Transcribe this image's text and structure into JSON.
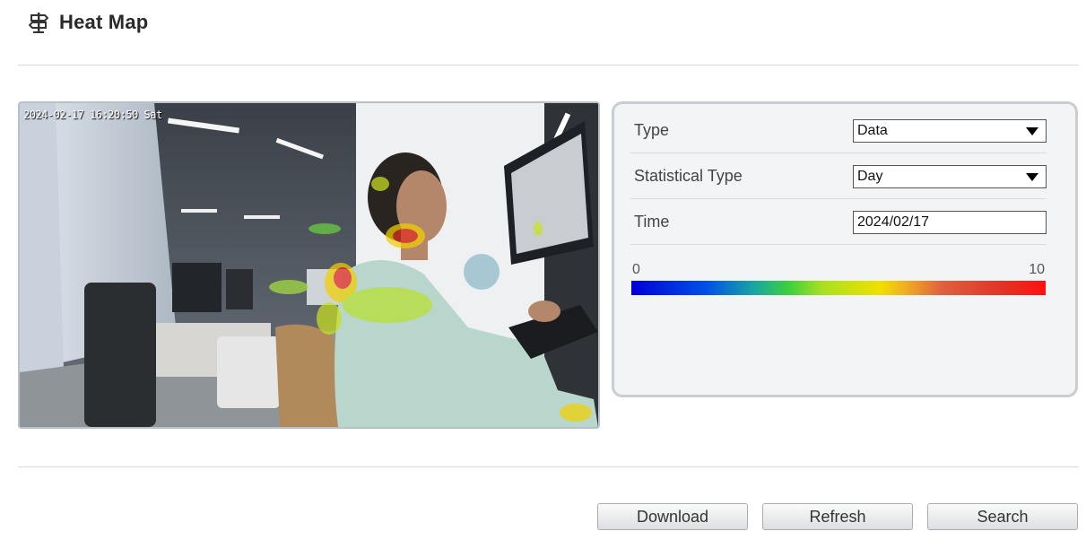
{
  "header": {
    "title": "Heat Map",
    "icon": "signpost-icon"
  },
  "video": {
    "osd_text": "2024-02-17 16:20:50 Sat"
  },
  "form": {
    "type": {
      "label": "Type",
      "value": "Data"
    },
    "statistical_type": {
      "label": "Statistical Type",
      "value": "Day"
    },
    "time": {
      "label": "Time",
      "value": "2024/02/17"
    }
  },
  "scale": {
    "min": "0",
    "max": "10"
  },
  "buttons": {
    "download": "Download",
    "refresh": "Refresh",
    "search": "Search"
  },
  "colors": {
    "scale_low": "#0000d8",
    "scale_mid": "#f0e000",
    "scale_high": "#ff1010"
  }
}
